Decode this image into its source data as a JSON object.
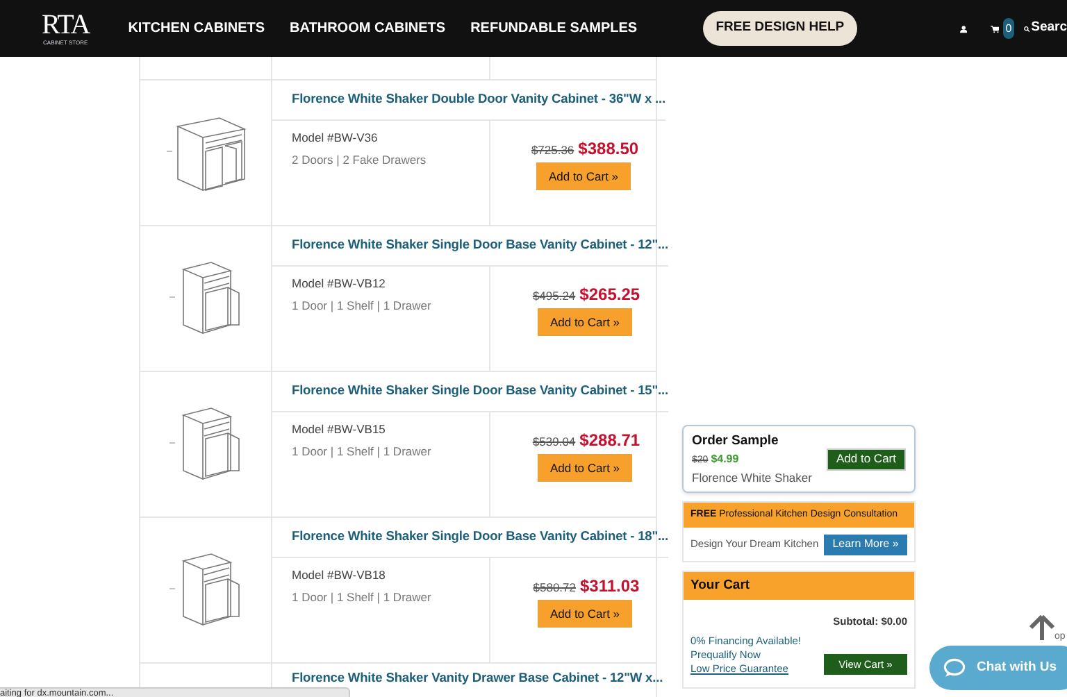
{
  "header": {
    "logo": {
      "title": "RTA",
      "subtitle": "CABINET STORE"
    },
    "nav": [
      "KITCHEN CABINETS",
      "BATHROOM CABINETS",
      "REFUNDABLE SAMPLES"
    ],
    "design_button": "FREE DESIGN HELP",
    "cart_count": "0",
    "search": "Searc"
  },
  "products": [
    {
      "kind": "double-door",
      "title": "Florence White Shaker Double Door Vanity Cabinet - 36\"W x ...",
      "model": "Model #BW-V36",
      "features": "2 Doors | 2 Fake Drawers",
      "old_price": "$725.36",
      "price": "$388.50",
      "button": "Add to Cart »"
    },
    {
      "kind": "single-door",
      "title": "Florence White Shaker Single Door Base Vanity Cabinet - 12\"...",
      "model": "Model #BW-VB12",
      "features": "1 Door | 1 Shelf | 1 Drawer",
      "old_price": "$495.24",
      "price": "$265.25",
      "button": "Add to Cart »"
    },
    {
      "kind": "single-door",
      "title": "Florence White Shaker Single Door Base Vanity Cabinet - 15\"...",
      "model": "Model #BW-VB15",
      "features": "1 Door | 1 Shelf | 1 Drawer",
      "old_price": "$539.04",
      "price": "$288.71",
      "button": "Add to Cart »"
    },
    {
      "kind": "single-door",
      "title": "Florence White Shaker Single Door Base Vanity Cabinet - 18\"...",
      "model": "Model #BW-VB18",
      "features": "1 Door | 1 Shelf | 1 Drawer",
      "old_price": "$580.72",
      "price": "$311.03",
      "button": "Add to Cart »"
    },
    {
      "title": "Florence White Shaker Vanity Drawer Base Cabinet - 12\"W x..."
    }
  ],
  "order_sample": {
    "title": "Order Sample",
    "old_price": "$20",
    "price": "$4.99",
    "name": "Florence White Shaker",
    "button": "Add to Cart"
  },
  "consultation": {
    "text": "**FREE** Professional Kitchen Design Consultation",
    "label": "Design Your Dream Kitchen",
    "button": "Learn More »"
  },
  "cart": {
    "title": "Your Cart",
    "subtotal": "Subtotal: $0.00",
    "links": [
      "0% Financing Available!",
      "Prequalify Now"
    ],
    "guarantee": "Low Price Guarantee",
    "button": "View Cart »"
  },
  "back_to_top": "op",
  "chat_button": "Chat with Us",
  "status_bar": "aiting for dx.mountain.com..."
}
